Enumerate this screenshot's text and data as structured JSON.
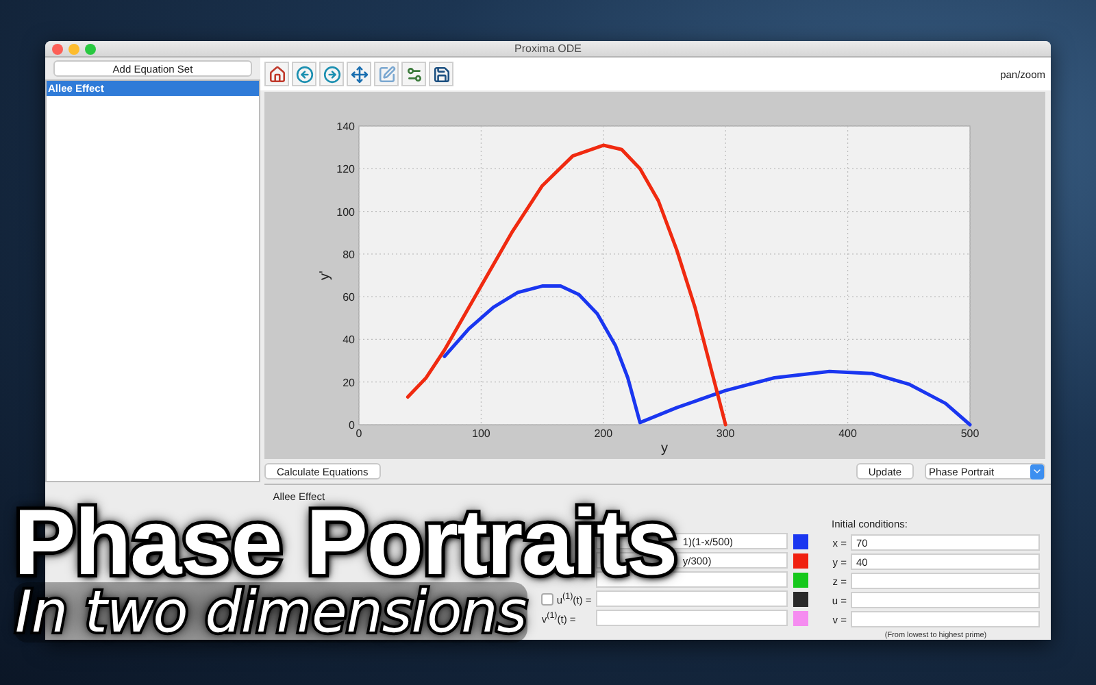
{
  "window": {
    "title": "Proxima ODE"
  },
  "sidebar": {
    "add_button": "Add Equation Set",
    "items": [
      {
        "label": "Allee Effect",
        "selected": true
      }
    ]
  },
  "toolbar": {
    "mode": "pan/zoom"
  },
  "chart_data": {
    "type": "line",
    "grid": true,
    "xlabel": "y",
    "ylabel": "y'",
    "xlim": [
      0,
      500
    ],
    "ylim": [
      0,
      140
    ],
    "xticks": [
      0,
      100,
      200,
      300,
      400,
      500
    ],
    "yticks": [
      0,
      20,
      40,
      60,
      80,
      100,
      120,
      140
    ],
    "series": [
      {
        "color": "#1a36f0",
        "x": [
          70,
          90,
          110,
          130,
          150,
          165,
          180,
          195,
          210,
          220,
          230,
          260,
          300,
          340,
          385,
          420,
          450,
          480,
          500
        ],
        "values": [
          32,
          45,
          55,
          62,
          65,
          65,
          61,
          52,
          37,
          22,
          1,
          8,
          16,
          22,
          25,
          24,
          19,
          10,
          0
        ]
      },
      {
        "color": "#f02a10",
        "x": [
          40,
          55,
          70,
          85,
          100,
          125,
          150,
          175,
          200,
          215,
          230,
          245,
          260,
          275,
          290,
          300
        ],
        "values": [
          13,
          22,
          35,
          50,
          65,
          90,
          112,
          126,
          131,
          129,
          120,
          105,
          82,
          55,
          22,
          0
        ]
      }
    ]
  },
  "actions": {
    "calculate": "Calculate Equations",
    "update": "Update",
    "plot_type": "Phase Portrait"
  },
  "panel": {
    "title": "Allee Effect",
    "equations": [
      {
        "value": "1)(1-x/500)",
        "color": "#1a36f0"
      },
      {
        "value": "y/300)",
        "color": "#f02010"
      },
      {
        "color": "#16c81c"
      },
      {
        "label": "u$^{(1)}$(t) =",
        "checked": false,
        "color": "#2a2a2a"
      },
      {
        "label": "v$^{(1)}$(t) =",
        "color": "#f58cf0"
      }
    ],
    "initial_conditions": {
      "label": "Initial conditions:",
      "rows": [
        {
          "label": "x =",
          "value": "70"
        },
        {
          "label": "y =",
          "value": "40"
        },
        {
          "label": "z ="
        },
        {
          "label": "u ="
        },
        {
          "label": "v ="
        }
      ],
      "note": "(From lowest to highest prime)"
    }
  },
  "overlay": {
    "headline": "Phase Portraits",
    "subheadline": "In two dimensions"
  }
}
